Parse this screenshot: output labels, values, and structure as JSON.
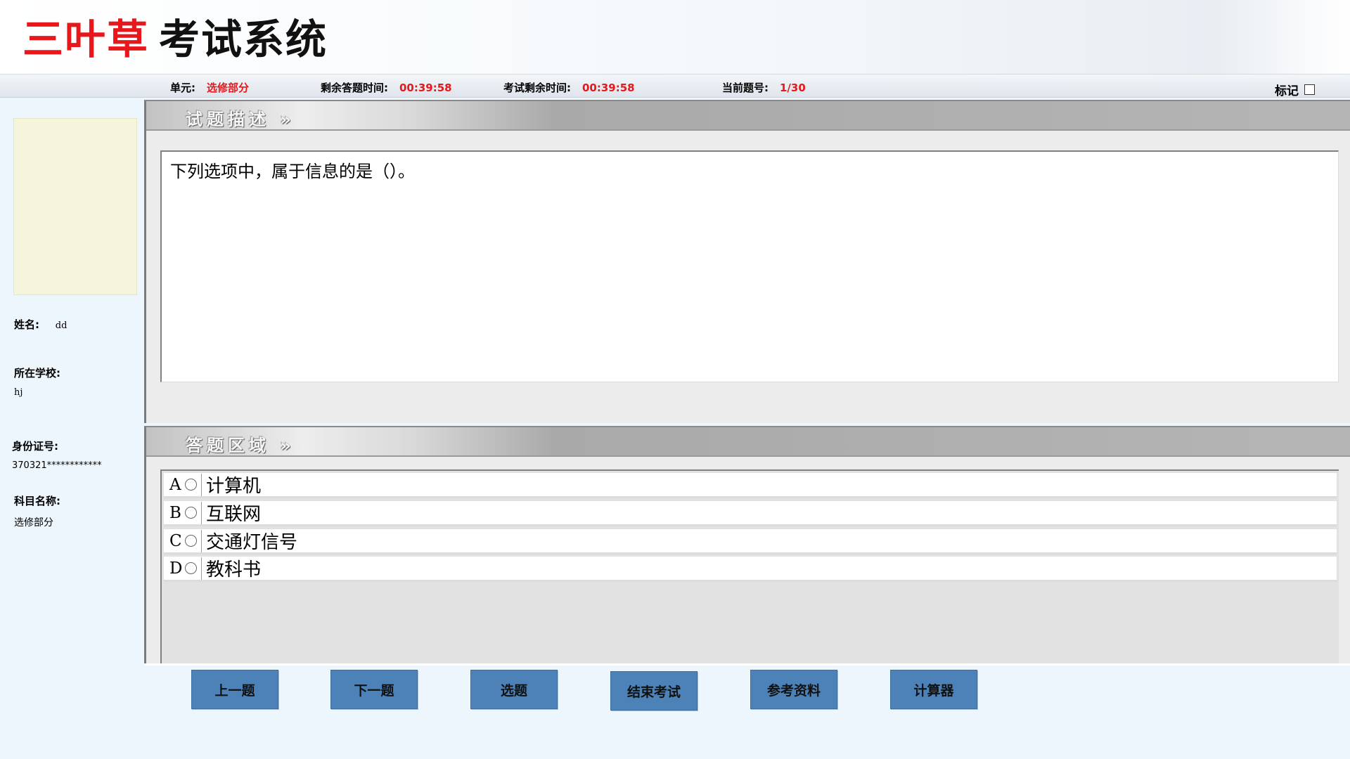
{
  "header": {
    "brand": "三叶草",
    "system_name": "考试系统"
  },
  "infobar": {
    "unit_label": "单元:",
    "unit_value": "选修部分",
    "answer_time_label": "剩余答题时间:",
    "answer_time_value": "00:39:58",
    "exam_time_label": "考试剩余时间:",
    "exam_time_value": "00:39:58",
    "current_label": "当前题号:",
    "current_value": "1/30",
    "mark_label": "标记",
    "mark_checked": false
  },
  "sidebar": {
    "name_label": "姓名:",
    "name_value": "dd",
    "school_label": "所在学校:",
    "school_value": "hj",
    "id_label": "身份证号:",
    "id_value": "370321************",
    "subject_label": "科目名称:",
    "subject_value": "选修部分"
  },
  "question_panel": {
    "title": "试题描述 »",
    "text": "下列选项中，属于信息的是（）。"
  },
  "answer_panel": {
    "title": "答题区域 »",
    "options": [
      {
        "letter": "A",
        "text": "计算机",
        "selected": false
      },
      {
        "letter": "B",
        "text": "互联网",
        "selected": false
      },
      {
        "letter": "C",
        "text": "交通灯信号",
        "selected": false
      },
      {
        "letter": "D",
        "text": "教科书",
        "selected": false
      }
    ]
  },
  "buttons": {
    "prev": "上一题",
    "next": "下一题",
    "select": "选题",
    "end_exam": "结束考试",
    "reference": "参考资料",
    "calculator": "计算器"
  },
  "colors": {
    "brand_red": "#e8171c",
    "button_blue": "#4c82b7",
    "page_bg": "#eef6fd"
  }
}
